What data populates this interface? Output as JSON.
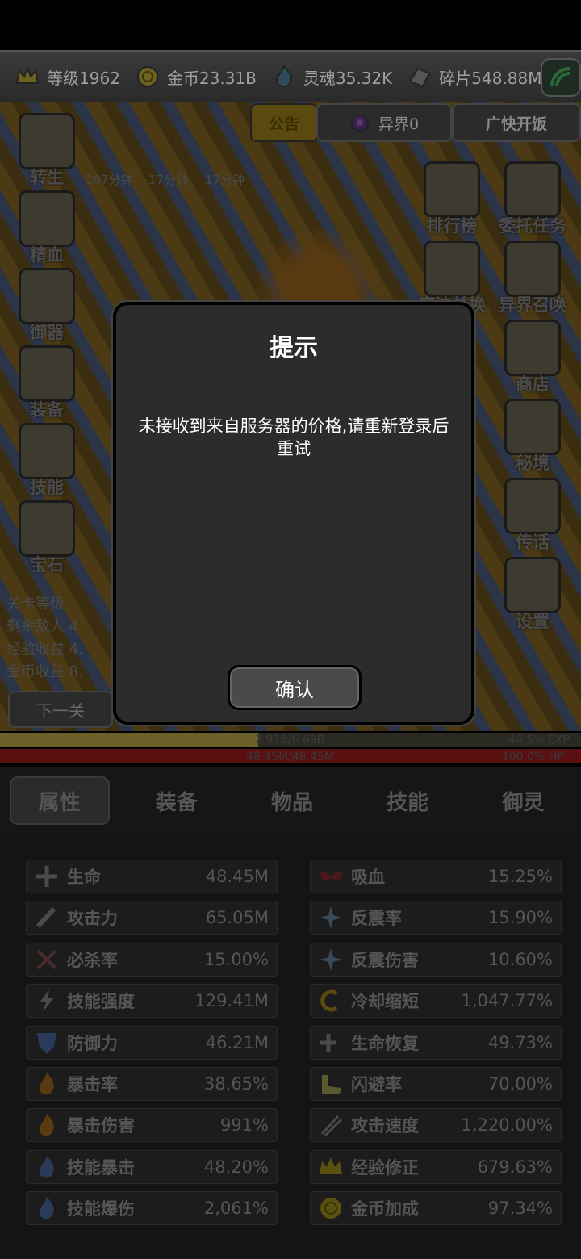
{
  "resources": [
    {
      "label": "等级1962",
      "icon": "crown-icon"
    },
    {
      "label": "金币23.31B",
      "icon": "coin-icon"
    },
    {
      "label": "灵魂35.32K",
      "icon": "soul-flame-icon"
    },
    {
      "label": "碎片548.88M",
      "icon": "shard-icon"
    }
  ],
  "top_buttons": {
    "notice": "公告",
    "otherworld": "异界0",
    "ad": "广快开饭"
  },
  "timers": [
    "107分钟",
    "17分钟",
    "17分钟"
  ],
  "left_menu": [
    "转生",
    "精血",
    "御器",
    "装备",
    "技能",
    "宝石"
  ],
  "right_menu": [
    "排行榜",
    "委托任务",
    "魔法兑换",
    "异界召唤",
    "商店",
    "秘境",
    "传话",
    "设置"
  ],
  "left_stats": [
    "关卡等级",
    "剩余敌人",
    "经验收益",
    "金币收益"
  ],
  "left_stat_values": [
    "",
    "4",
    "4.",
    "8."
  ],
  "next_level": "下一关",
  "exp_bar": {
    "text": "2.97B/6.69B",
    "percent_text": "44.5% EXP",
    "fraction": 0.445
  },
  "hp_bar": {
    "text": "48.45M/48.45M",
    "percent_text": "100.0%  HP",
    "fraction": 1.0
  },
  "tabs": [
    "属性",
    "装备",
    "物品",
    "技能",
    "御灵"
  ],
  "attributes_left": [
    {
      "name": "生命",
      "value": "48.45M",
      "icon": "plus-sword-icon"
    },
    {
      "name": "攻击力",
      "value": "65.05M",
      "icon": "sword-icon"
    },
    {
      "name": "必杀率",
      "value": "15.00%",
      "icon": "crossed-swords-icon"
    },
    {
      "name": "技能强度",
      "value": "129.41M",
      "icon": "lightning-icon"
    },
    {
      "name": "防御力",
      "value": "46.21M",
      "icon": "shield-icon"
    },
    {
      "name": "暴击率",
      "value": "38.65%",
      "icon": "fire-icon"
    },
    {
      "name": "暴击伤害",
      "value": "991%",
      "icon": "fire-icon"
    },
    {
      "name": "技能暴击",
      "value": "48.20%",
      "icon": "blue-fire-icon"
    },
    {
      "name": "技能爆伤",
      "value": "2,061%",
      "icon": "blue-fire-icon"
    }
  ],
  "attributes_right": [
    {
      "name": "吸血",
      "value": "15.25%",
      "icon": "bat-icon"
    },
    {
      "name": "反震率",
      "value": "15.90%",
      "icon": "spike-icon"
    },
    {
      "name": "反震伤害",
      "value": "10.60%",
      "icon": "spike-icon"
    },
    {
      "name": "冷却缩短",
      "value": "1,047.77%",
      "icon": "cooldown-icon"
    },
    {
      "name": "生命恢复",
      "value": "49.73%",
      "icon": "regen-icon"
    },
    {
      "name": "闪避率",
      "value": "70.00%",
      "icon": "boot-icon"
    },
    {
      "name": "攻击速度",
      "value": "1,220.00%",
      "icon": "speed-sword-icon"
    },
    {
      "name": "经验修正",
      "value": "679.63%",
      "icon": "crown-icon"
    },
    {
      "name": "金币加成",
      "value": "97.34%",
      "icon": "coin-icon"
    }
  ],
  "dialog": {
    "title": "提示",
    "message": "未接收到来自服务器的价格,请重新登录后重试",
    "confirm": "确认"
  },
  "colors": {
    "accent_gold": "#6b6128",
    "hp_red": "#5a1010",
    "dialog_bg": "#2c2c2c"
  }
}
